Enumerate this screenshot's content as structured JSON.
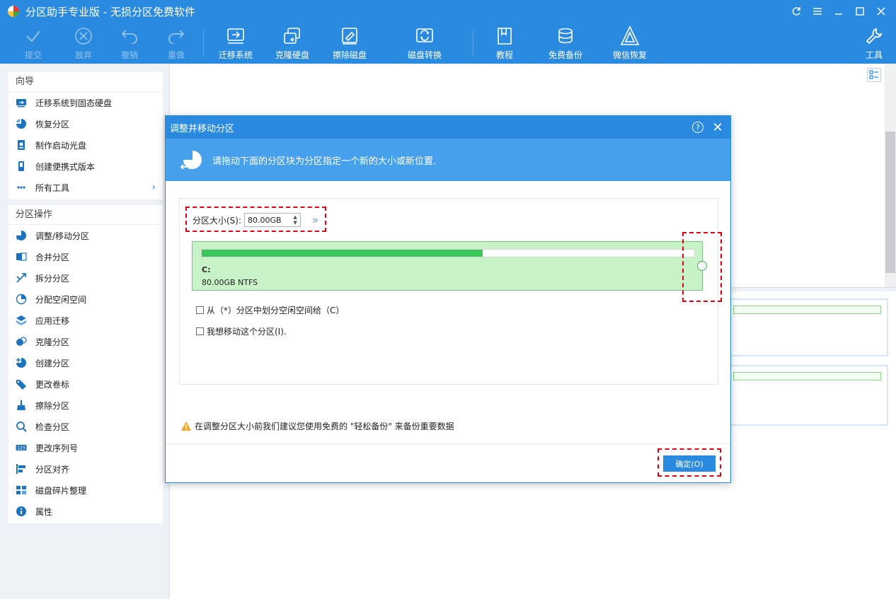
{
  "app": {
    "title": "分区助手专业版 - 无损分区免费软件"
  },
  "window_controls": [
    "refresh-icon",
    "menu-icon",
    "minimize-icon",
    "maximize-icon",
    "close-icon"
  ],
  "toolbar": {
    "buttons": [
      {
        "label": "提交",
        "icon": "check-icon",
        "enabled": false
      },
      {
        "label": "放弃",
        "icon": "discard-icon",
        "enabled": false
      },
      {
        "label": "撤销",
        "icon": "undo-icon",
        "enabled": false
      },
      {
        "label": "重做",
        "icon": "redo-icon",
        "enabled": false
      },
      {
        "label": "迁移系统",
        "icon": "migrate-os-icon",
        "enabled": true
      },
      {
        "label": "克隆硬盘",
        "icon": "clone-disk-icon",
        "enabled": true
      },
      {
        "label": "擦除磁盘",
        "icon": "wipe-disk-icon",
        "enabled": true
      },
      {
        "label": "磁盘转换",
        "icon": "convert-disk-icon",
        "enabled": true
      },
      {
        "label": "教程",
        "icon": "book-icon",
        "enabled": true
      },
      {
        "label": "免费备份",
        "icon": "backup-icon",
        "enabled": true
      },
      {
        "label": "微信恢复",
        "icon": "wechat-recover-icon",
        "enabled": true
      },
      {
        "label": "工具",
        "icon": "wrench-icon",
        "enabled": true
      }
    ]
  },
  "sidebar": {
    "wizard": {
      "title": "向导",
      "items": [
        {
          "label": "迁移系统到固态硬盘",
          "icon": "migrate-ssd-icon"
        },
        {
          "label": "恢复分区",
          "icon": "recover-partition-icon"
        },
        {
          "label": "制作启动光盘",
          "icon": "bootable-media-icon"
        },
        {
          "label": "创建便携式版本",
          "icon": "portable-version-icon"
        },
        {
          "label": "所有工具",
          "icon": "all-tools-icon",
          "chevron": "›"
        }
      ]
    },
    "operations": {
      "title": "分区操作",
      "items": [
        {
          "label": "调整/移动分区",
          "icon": "resize-partition-icon"
        },
        {
          "label": "合并分区",
          "icon": "merge-partition-icon"
        },
        {
          "label": "拆分分区",
          "icon": "split-partition-icon"
        },
        {
          "label": "分配空闲空间",
          "icon": "allocate-space-icon"
        },
        {
          "label": "应用迁移",
          "icon": "app-migrate-icon"
        },
        {
          "label": "克隆分区",
          "icon": "clone-partition-icon"
        },
        {
          "label": "创建分区",
          "icon": "create-partition-icon"
        },
        {
          "label": "更改卷标",
          "icon": "label-tag-icon"
        },
        {
          "label": "擦除分区",
          "icon": "wipe-partition-icon"
        },
        {
          "label": "检查分区",
          "icon": "check-partition-icon"
        },
        {
          "label": "更改序列号",
          "icon": "serial-number-icon"
        },
        {
          "label": "分区对齐",
          "icon": "align-partition-icon"
        },
        {
          "label": "磁盘碎片整理",
          "icon": "defrag-icon"
        },
        {
          "label": "属性",
          "icon": "info-icon"
        }
      ]
    }
  },
  "dialog": {
    "title": "调整并移动分区",
    "banner_text": "请拖动下面的分区块为分区指定一个新的大小或新位置.",
    "size_label": "分区大小(S):",
    "size_value": "80.00GB",
    "expand_chevron": "»",
    "partition": {
      "letter": "C:",
      "info": "80.00GB NTFS",
      "used_fraction": 0.57
    },
    "checkbox_1": "从（*）分区中划分空闲空间给（C）",
    "checkbox_2": "我想移动这个分区(I).",
    "warning": "在调整分区大小前我们建议您使用免费的 \"轻松备份\" 来备份重要数据",
    "ok_label": "确定(O)"
  },
  "colors": {
    "accent": "#2a8ae0",
    "banner": "#46a0ec",
    "partition_fill": "#c8f2c8",
    "usage_fill": "#3cc75a",
    "highlight_dash": "#e00012"
  }
}
